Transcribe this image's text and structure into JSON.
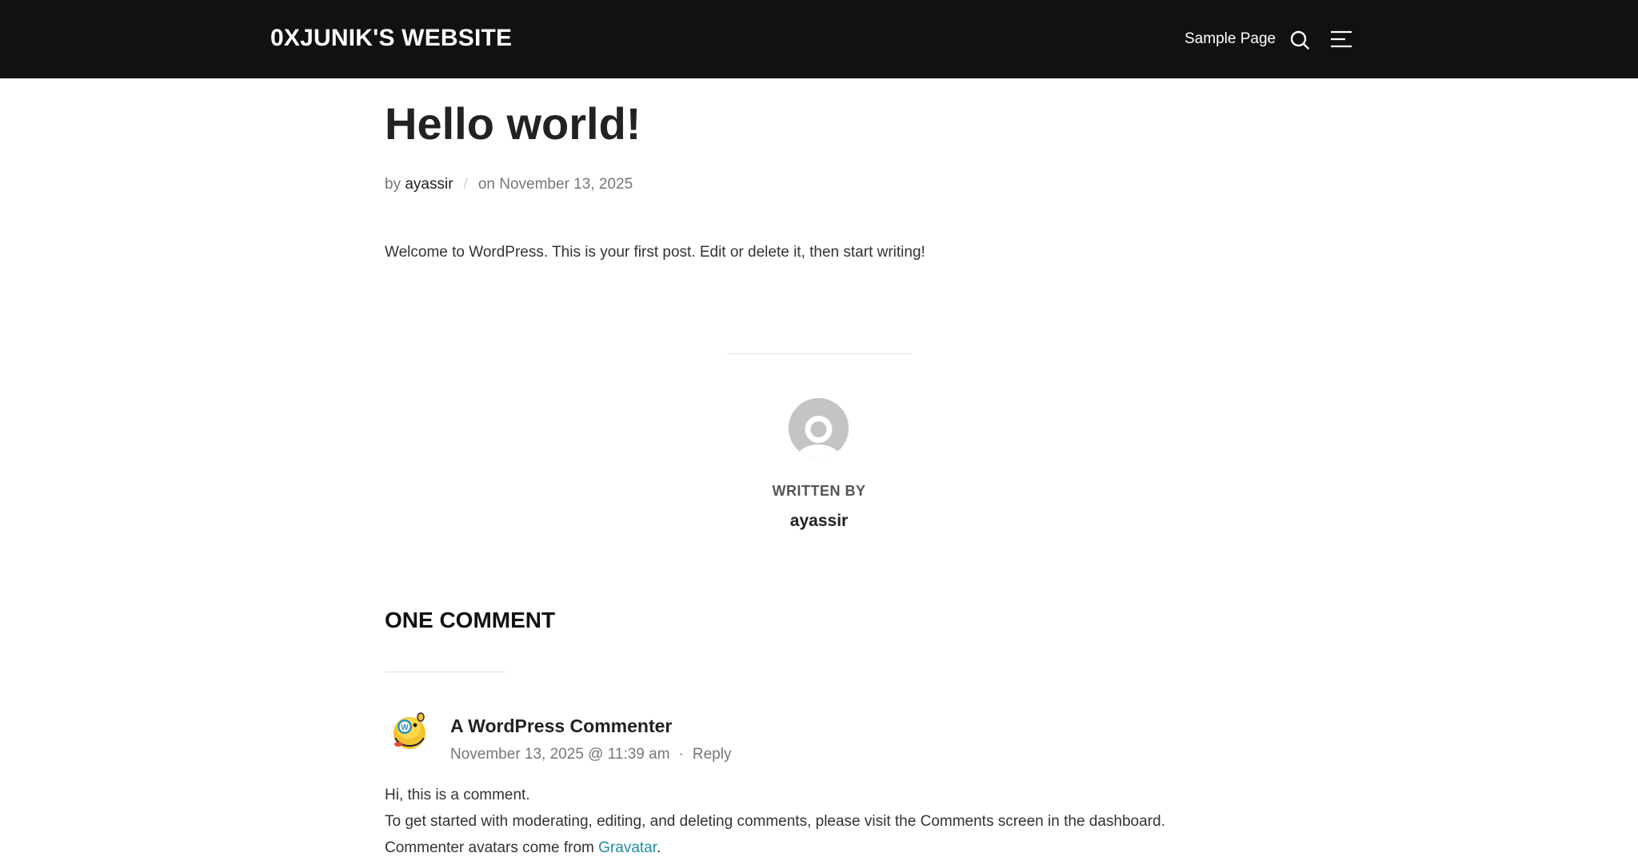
{
  "header": {
    "site_title": "0XJUNIK'S WEBSITE",
    "nav": {
      "sample_page": "Sample Page"
    },
    "icons": {
      "search": "search-icon",
      "menu": "menu-icon"
    }
  },
  "post": {
    "title": "Hello world!",
    "meta": {
      "by_label": "by",
      "author": "ayassir",
      "separator": "/",
      "on_label": "on",
      "date": "November 13, 2025"
    },
    "content": "Welcome to WordPress. This is your first post. Edit or delete it, then start writing!"
  },
  "author_box": {
    "written_by": "WRITTEN BY",
    "name": "ayassir"
  },
  "comments": {
    "title": "ONE COMMENT",
    "items": [
      {
        "author": "A WordPress Commenter",
        "date": "November 13, 2025 @ 11:39 am",
        "dot": "·",
        "reply": "Reply",
        "line1": "Hi, this is a comment.",
        "line2": "To get started with moderating, editing, and deleting comments, please visit the Comments screen in the dashboard.",
        "line3_prefix": "Commenter avatars come from ",
        "line3_link": "Gravatar",
        "line3_suffix": "."
      }
    ]
  },
  "colors": {
    "header_bg": "#111111",
    "link_accent": "#1f8fa0",
    "avatar_gray": "#c4c4c4"
  }
}
